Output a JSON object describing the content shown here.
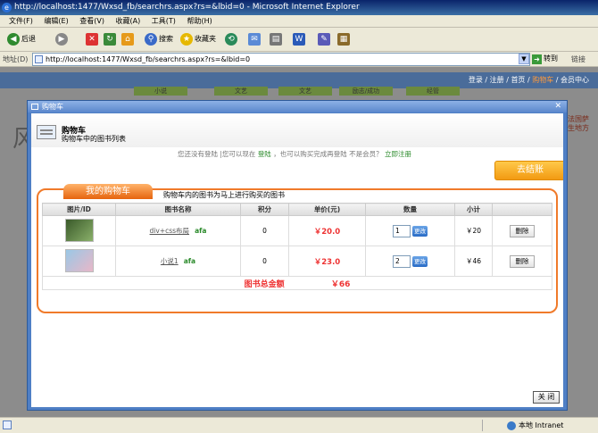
{
  "window": {
    "title": "http://localhost:1477/Wxsd_fb/searchrs.aspx?rs=&lbid=0 - Microsoft Internet Explorer"
  },
  "menu": [
    "文件(F)",
    "编辑(E)",
    "查看(V)",
    "收藏(A)",
    "工具(T)",
    "帮助(H)"
  ],
  "toolbar": {
    "back": "后退",
    "search": "搜索",
    "favorites": "收藏夹"
  },
  "address": {
    "label": "地址(D)",
    "url": "http://localhost:1477/Wxsd_fb/searchrs.aspx?rs=&lbid=0",
    "go": "转到",
    "links": "链接"
  },
  "background_page": {
    "nav_links": [
      "登录",
      "注册",
      "首页",
      "购物车",
      "会员中心"
    ],
    "nav_current": "购物车",
    "tabs": [
      "小说",
      "文艺",
      "文艺",
      "励志/成功",
      "经管"
    ],
    "left_text": "风",
    "right_text": [
      "法国萨",
      "生地方"
    ]
  },
  "modal": {
    "title": "购物车",
    "header_title": "购物车",
    "header_subtitle": "购物车中的图书列表",
    "notice_pre": "您还没有登陆 |您可以现在",
    "notice_login": "登陆",
    "notice_mid": "，也可以购买完成再登陆  不是会员？",
    "notice_register": "立即注册",
    "checkout_label": "去结账",
    "panel_tab": "我的购物车",
    "panel_note": "购物车内的图书为马上进行购买的图书",
    "columns": [
      "图片/ID",
      "图书名称",
      "积分",
      "单价(元)",
      "数量",
      "小计",
      ""
    ],
    "rows": [
      {
        "name": "div+css布局",
        "author": "afa",
        "points": "0",
        "price": "￥20.0",
        "qty": "1",
        "update": "更改",
        "subtotal": "￥20",
        "delete": "删除"
      },
      {
        "name": "小说1",
        "author": "afa",
        "points": "0",
        "price": "￥23.0",
        "qty": "2",
        "update": "更改",
        "subtotal": "￥46",
        "delete": "删除"
      }
    ],
    "total_label": "图书总金额",
    "total_value": "￥66",
    "close_label": "关 闭"
  },
  "status": {
    "zone": "本地 Intranet"
  },
  "colors": {
    "accent": "#f07a2a",
    "price": "#e33333",
    "link_green": "#2a8a2a",
    "modal_border": "#4f7fc5"
  }
}
